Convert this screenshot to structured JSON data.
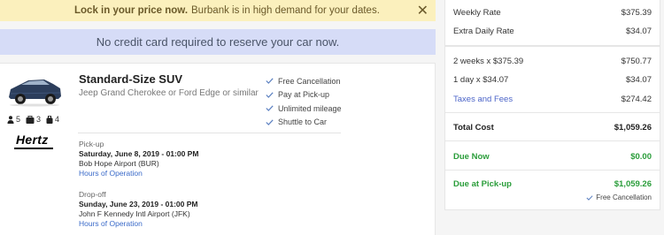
{
  "banner": {
    "bold": "Lock in your price now.",
    "text": "Burbank is in high demand for your dates.",
    "close": "✕"
  },
  "no_credit_card": "No credit card required to reserve your car now.",
  "car": {
    "title": "Standard-Size SUV",
    "subtitle": "Jeep Grand Cherokee or Ford Edge or similar",
    "specs": {
      "passengers": "5",
      "large_bags": "3",
      "small_bags": "4"
    },
    "vendor": "Hertz",
    "features": [
      "Free Cancellation",
      "Pay at Pick-up",
      "Unlimited mileage",
      "Shuttle to Car"
    ]
  },
  "pickup": {
    "label": "Pick-up",
    "date": "Saturday, June 8, 2019 - 01:00 PM",
    "place": "Bob Hope Airport (BUR)",
    "hours_link": "Hours of Operation"
  },
  "dropoff": {
    "label": "Drop-off",
    "date": "Sunday, June 23, 2019 - 01:00 PM",
    "place": "John F Kennedy Intl Airport (JFK)",
    "hours_link": "Hours of Operation"
  },
  "rates": {
    "weekly_label": "Weekly Rate",
    "weekly_value": "$375.39",
    "extra_label": "Extra Daily Rate",
    "extra_value": "$34.07",
    "weeks_label": "2 weeks x $375.39",
    "weeks_value": "$750.77",
    "day_label": "1 day x $34.07",
    "day_value": "$34.07",
    "taxes_label": "Taxes and Fees",
    "taxes_value": "$274.42",
    "total_label": "Total Cost",
    "total_value": "$1,059.26",
    "due_now_label": "Due Now",
    "due_now_value": "$0.00",
    "due_pickup_label": "Due at Pick-up",
    "due_pickup_value": "$1,059.26",
    "free_cancel": "Free Cancellation"
  },
  "colors": {
    "banner_bg": "#fbf0bd",
    "info_bg": "#d6dcf7",
    "link": "#3a6ac9",
    "green": "#2a9d3a"
  }
}
